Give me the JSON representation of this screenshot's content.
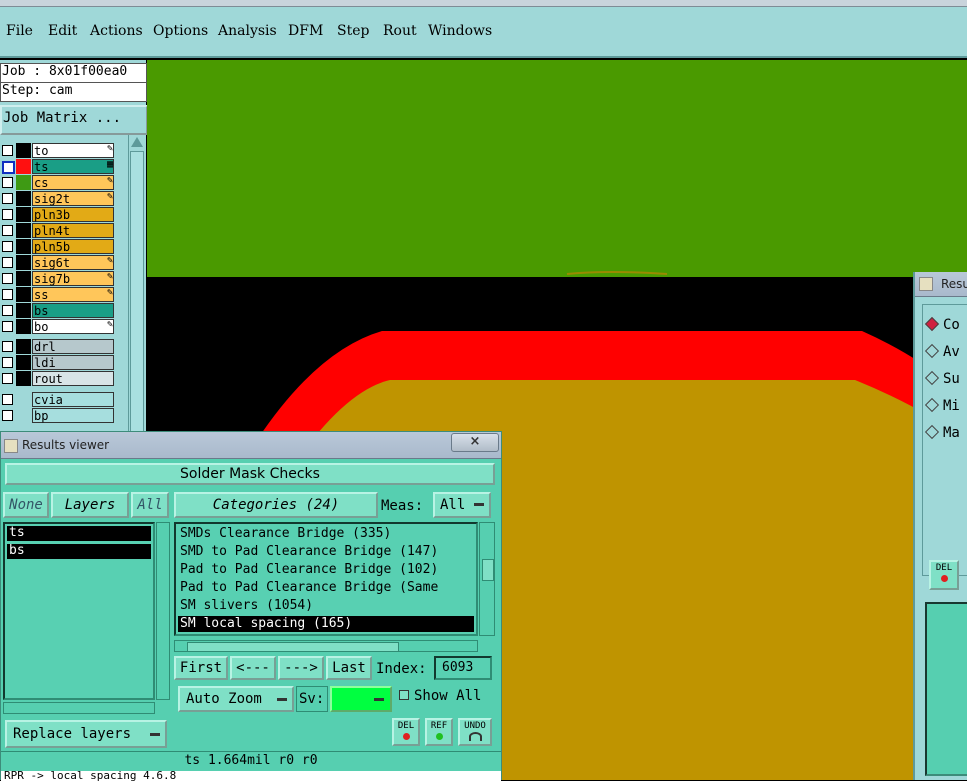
{
  "menu": [
    {
      "label": "File"
    },
    {
      "label": "Edit"
    },
    {
      "label": "Actions"
    },
    {
      "label": "Options"
    },
    {
      "label": "Analysis"
    },
    {
      "label": "DFM"
    },
    {
      "label": "Step"
    },
    {
      "label": "Rout"
    },
    {
      "label": "Windows"
    }
  ],
  "left_panel": {
    "job_label": "Job : 8x01f00ea0",
    "step_label": "Step: cam",
    "job_matrix_button": "Job Matrix ...",
    "layers": [
      {
        "name": "to",
        "color": "#ffffff",
        "swatch": "#000000",
        "mark": "pen"
      },
      {
        "name": "ts",
        "color": "#1a9e86",
        "swatch": "#ff1010",
        "mark": "grid",
        "checked_blue": true
      },
      {
        "name": "cs",
        "color": "#ffc65a",
        "swatch": "#3e9a14",
        "mark": "pen"
      },
      {
        "name": "sig2t",
        "color": "#ffc65a",
        "swatch": "#000000",
        "mark": "pen"
      },
      {
        "name": "pln3b",
        "color": "#e2aa16",
        "swatch": "#000000",
        "mark": ""
      },
      {
        "name": "pln4t",
        "color": "#e2aa16",
        "swatch": "#000000",
        "mark": ""
      },
      {
        "name": "pln5b",
        "color": "#e2aa16",
        "swatch": "#000000",
        "mark": ""
      },
      {
        "name": "sig6t",
        "color": "#ffc65a",
        "swatch": "#000000",
        "mark": "pen"
      },
      {
        "name": "sig7b",
        "color": "#ffc65a",
        "swatch": "#000000",
        "mark": "pen"
      },
      {
        "name": "ss",
        "color": "#ffc65a",
        "swatch": "#000000",
        "mark": "pen"
      },
      {
        "name": "bs",
        "color": "#1a9e86",
        "swatch": "#000000",
        "mark": ""
      },
      {
        "name": "bo",
        "color": "#ffffff",
        "swatch": "#000000",
        "mark": "pen"
      },
      {
        "name": "drl",
        "color": "#b6c8cc",
        "swatch": "#000000",
        "mark": ""
      },
      {
        "name": "ldi",
        "color": "#b6c8cc",
        "swatch": "#000000",
        "mark": ""
      },
      {
        "name": "rout",
        "color": "#d8e4e6",
        "swatch": "#000000",
        "mark": ""
      },
      {
        "name": "cvia",
        "color": "#a6dede",
        "swatch": "#9fd8d8",
        "mark": ""
      },
      {
        "name": "bp",
        "color": "#a6dede",
        "swatch": "#9fd8d8",
        "mark": ""
      }
    ]
  },
  "results_viewer": {
    "title": "Results viewer",
    "close_label": "×",
    "header": "Solder Mask Checks",
    "none_label": "None",
    "layers_label": "Layers",
    "all_label": "All",
    "layers_list": [
      "ts",
      "bs"
    ],
    "categories_label": "Categories (24)",
    "meas_label": "Meas:",
    "meas_value": "All",
    "categories": [
      "SMDs Clearance Bridge (335)",
      "SMD to Pad Clearance Bridge (147)",
      "Pad to Pad Clearance Bridge (102)",
      "Pad to Pad Clearance Bridge (Same",
      "SM slivers (1054)",
      "SM local spacing (165)"
    ],
    "selected_category_index": 5,
    "first_label": "First",
    "prev_label": "<---",
    "next_label": "--->",
    "last_label": "Last",
    "index_label": "Index:",
    "index_value": "6093",
    "auto_zoom_label": "Auto Zoom",
    "sv_label": "Sv:",
    "show_all_label": "Show All",
    "replace_layers_label": "Replace layers",
    "del_label": "DEL",
    "ref_label": "REF",
    "undo_label": "UNDO",
    "status_line": "ts 1.664mil  r0  r0",
    "bottom_line": "RPR -> local spacing  4.6.8"
  },
  "right_window": {
    "title": "Resu",
    "options": [
      "Co",
      "Av",
      "Su",
      "Mi",
      "Ma"
    ],
    "del_label": "DEL"
  },
  "colors": {
    "menu_bg": "#9fd8d8",
    "viewer_bg": "#56cfb0",
    "canvas_green": "#4a9a00",
    "canvas_red": "#ff0000",
    "canvas_gold": "#bf9400"
  }
}
